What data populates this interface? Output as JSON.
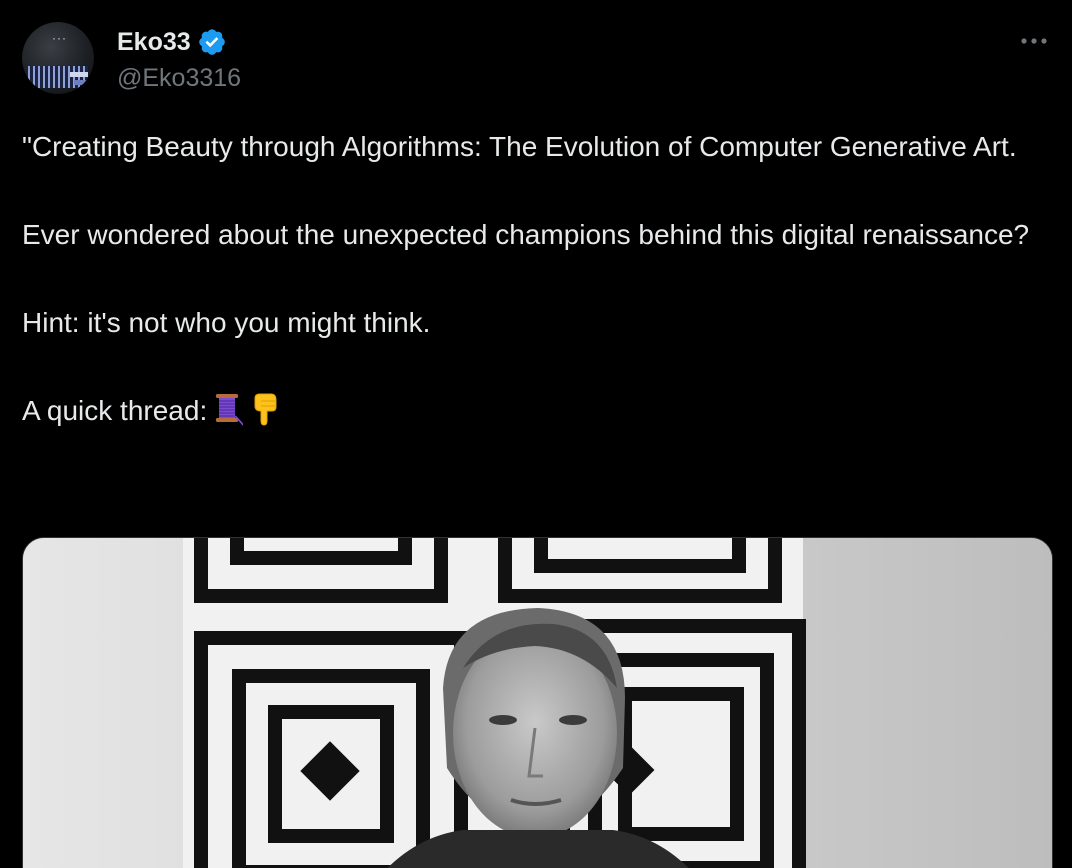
{
  "author": {
    "display_name": "Eko33",
    "handle": "@Eko3316",
    "avatar_icon": "avatar-image",
    "verified": true,
    "badge_color": "#1d9bf0"
  },
  "more_icon": "ellipsis-icon",
  "tweet": {
    "paragraphs": [
      "\"Creating Beauty through Algorithms: The Evolution of Computer Generative Art.",
      "Ever wondered about the unexpected champions behind this digital renaissance?",
      "Hint: it's not who you might think.",
      "A quick thread:"
    ],
    "thread_emojis": [
      "spool-of-thread-icon",
      "pointing-down-icon"
    ]
  },
  "media": {
    "type": "photo",
    "style": "black-and-white"
  },
  "colors": {
    "background": "#000000",
    "text_primary": "#e7e9ea",
    "text_secondary": "#71767b",
    "verified_blue": "#1d9bf0"
  }
}
